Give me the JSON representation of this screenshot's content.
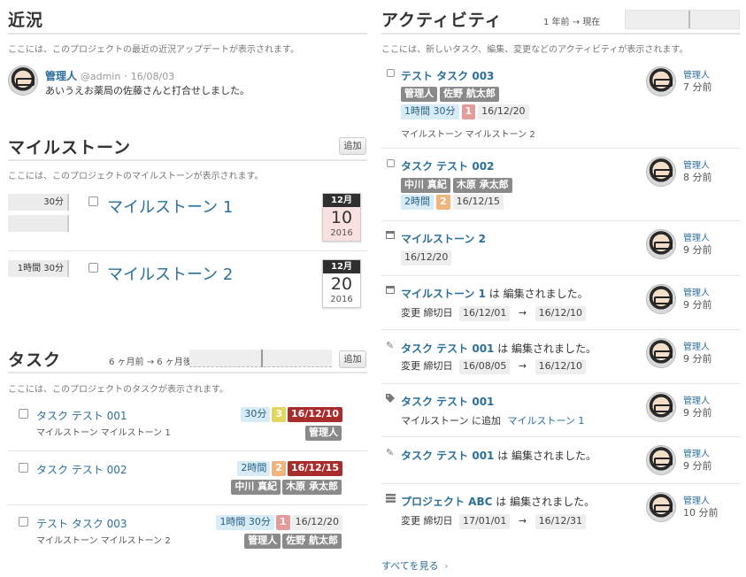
{
  "recent": {
    "title": "近況",
    "desc": "ここには、このプロジェクトの最近の近況アップデートが表示されます。",
    "post": {
      "author": "管理人",
      "handle": "@admin",
      "sep": "·",
      "date": "16/08/03",
      "text": "あいうえお薬局の佐藤さんと打合せしました。"
    }
  },
  "milestones": {
    "title": "マイルストーン",
    "add_label": "追加",
    "desc": "ここには、このプロジェクトのマイルストーンが表示されます。",
    "items": [
      {
        "time": "30分",
        "name": "マイルストーン 1",
        "cal_month": "12月",
        "cal_day": "10",
        "cal_year": "2016"
      },
      {
        "time": "1時間 30分",
        "name": "マイルストーン 2",
        "cal_month": "12月",
        "cal_day": "20",
        "cal_year": "2016"
      }
    ]
  },
  "tasks": {
    "title": "タスク",
    "range": "6 ヶ月前 → 6 ヶ月後",
    "add_label": "追加",
    "desc": "ここには、このプロジェクトのタスクが表示されます。",
    "items": [
      {
        "name": "タスク テスト 001",
        "time": "30分",
        "count": "3",
        "date": "16/12/10",
        "sub": "マイルストーン マイルストーン 1",
        "assignees": [
          "管理人"
        ]
      },
      {
        "name": "タスク テスト 002",
        "time": "2時間",
        "count": "2",
        "date": "16/12/15",
        "sub": "",
        "assignees": [
          "中川 真紀",
          "木原 承太郎"
        ]
      },
      {
        "name": "テスト タスク 003",
        "time": "1時間 30分",
        "count": "1",
        "date": "16/12/20",
        "sub": "マイルストーン マイルストーン 2",
        "assignees": [
          "管理人",
          "佐野 航太郎"
        ]
      }
    ]
  },
  "activity": {
    "title": "アクティビティ",
    "range": "1 年前 → 現在",
    "desc": "ここには、新しいタスク、編集、変更などのアクティビティが表示されます。",
    "items": [
      {
        "title": "テスト タスク 003",
        "tags": [
          "管理人",
          "佐野 航太郎"
        ],
        "time": "1時間 30分",
        "count": "1",
        "date": "16/12/20",
        "milestone": "マイルストーン マイルストーン 2",
        "user": "管理人",
        "ago": "7 分前"
      },
      {
        "title": "タスク テスト 002",
        "tags": [
          "中川 真紀",
          "木原 承太郎"
        ],
        "time": "2時間",
        "count": "2",
        "date": "16/12/15",
        "user": "管理人",
        "ago": "8 分前"
      },
      {
        "title": "マイルストーン 2",
        "date": "16/12/20",
        "user": "管理人",
        "ago": "9 分前"
      },
      {
        "title": "マイルストーン 1",
        "suffix": "は 編集されました。",
        "change": "変更 締切日",
        "from": "16/12/01",
        "arrow": "→",
        "to": "16/12/10",
        "user": "管理人",
        "ago": "9 分前"
      },
      {
        "title": "タスク テスト 001",
        "suffix": "は 編集されました。",
        "change": "変更 締切日",
        "from": "16/08/05",
        "arrow": "→",
        "to": "16/12/10",
        "user": "管理人",
        "ago": "9 分前"
      },
      {
        "title": "タスク テスト 001",
        "added": "マイルストーン に追加",
        "added_link": "マイルストーン 1",
        "user": "管理人",
        "ago": "9 分前"
      },
      {
        "title": "タスク テスト 001",
        "suffix": "は 編集されました。",
        "user": "管理人",
        "ago": "9 分前"
      },
      {
        "title": "プロジェクト ABC",
        "suffix": "は 編集されました。",
        "change": "変更 締切日",
        "from": "17/01/01",
        "arrow": "→",
        "to": "16/12/31",
        "user": "管理人",
        "ago": "10 分前"
      }
    ],
    "see_all": "すべてを見る",
    "see_all_chevron": "›"
  }
}
